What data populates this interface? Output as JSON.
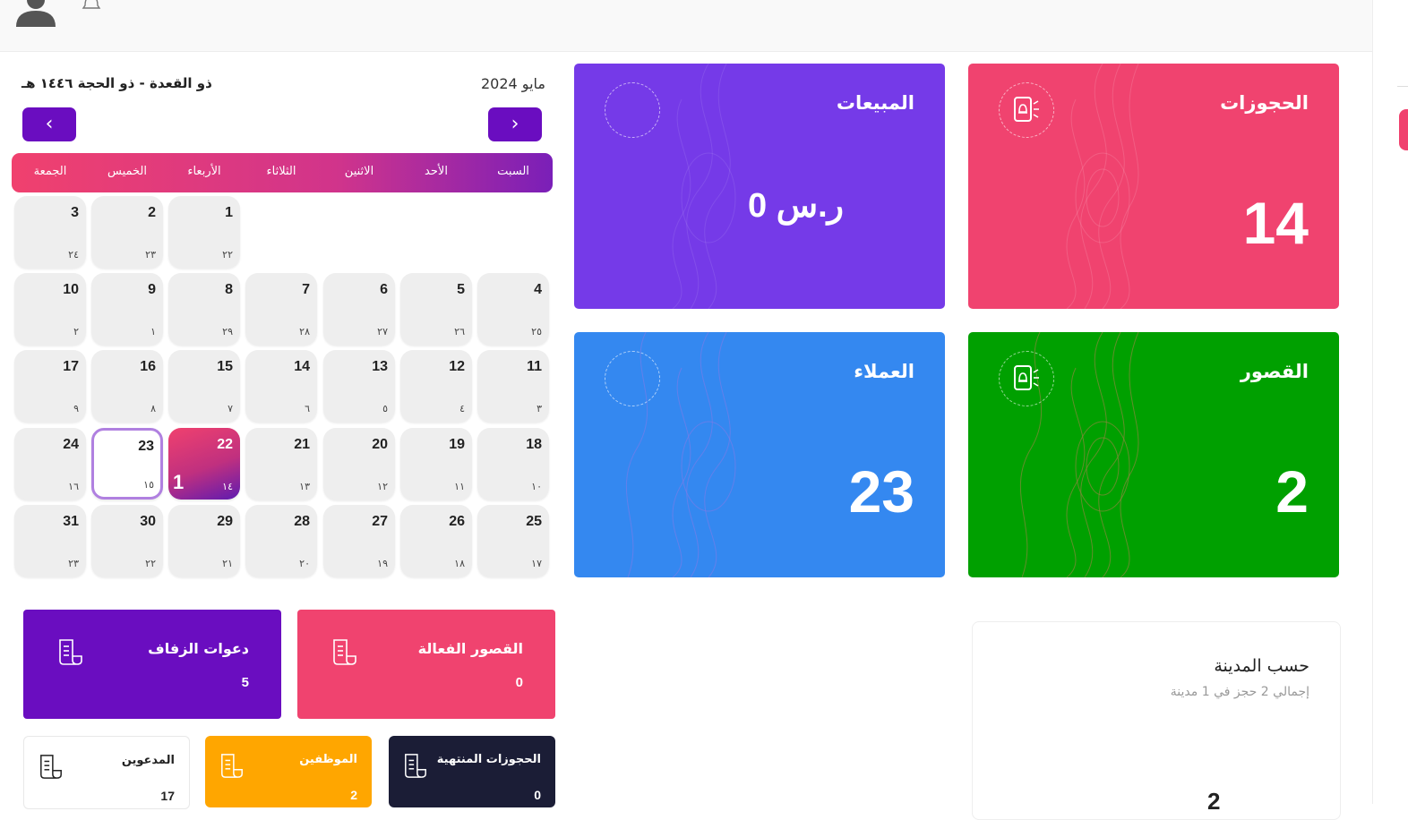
{
  "stats": {
    "bookings": {
      "title": "الحجوزات",
      "value": "14",
      "color": "#f0436f"
    },
    "sales": {
      "title": "المبيعات",
      "value": "0 ر.س",
      "color": "#753ae8"
    },
    "palaces": {
      "title": "القصور",
      "value": "2",
      "color": "#00a000"
    },
    "customers": {
      "title": "العملاء",
      "value": "23",
      "color": "#3488f0"
    }
  },
  "calendar": {
    "month_label": "مايو 2024",
    "hijri_label": "ذو القعدة - ذو الحجة ١٤٤٦ هـ",
    "prev_arrow": "‹",
    "next_arrow": "›",
    "weekdays": [
      "السبت",
      "الأحد",
      "الاثنين",
      "الثلاثاء",
      "الأربعاء",
      "الخميس",
      "الجمعة"
    ],
    "weeks": [
      [
        null,
        null,
        null,
        null,
        {
          "g": "1",
          "h": "٢٢"
        },
        {
          "g": "2",
          "h": "٢٣"
        },
        {
          "g": "3",
          "h": "٢٤"
        }
      ],
      [
        {
          "g": "4",
          "h": "٢٥"
        },
        {
          "g": "5",
          "h": "٢٦"
        },
        {
          "g": "6",
          "h": "٢٧"
        },
        {
          "g": "7",
          "h": "٢٨"
        },
        {
          "g": "8",
          "h": "٢٩"
        },
        {
          "g": "9",
          "h": "١"
        },
        {
          "g": "10",
          "h": "٢"
        }
      ],
      [
        {
          "g": "11",
          "h": "٣"
        },
        {
          "g": "12",
          "h": "٤"
        },
        {
          "g": "13",
          "h": "٥"
        },
        {
          "g": "14",
          "h": "٦"
        },
        {
          "g": "15",
          "h": "٧"
        },
        {
          "g": "16",
          "h": "٨"
        },
        {
          "g": "17",
          "h": "٩"
        }
      ],
      [
        {
          "g": "18",
          "h": "١٠"
        },
        {
          "g": "19",
          "h": "١١"
        },
        {
          "g": "20",
          "h": "١٢"
        },
        {
          "g": "21",
          "h": "١٣"
        },
        {
          "g": "22",
          "h": "١٤",
          "count": "1",
          "active": true
        },
        {
          "g": "23",
          "h": "١٥",
          "today": true
        },
        {
          "g": "24",
          "h": "١٦"
        }
      ],
      [
        {
          "g": "25",
          "h": "١٧"
        },
        {
          "g": "26",
          "h": "١٨"
        },
        {
          "g": "27",
          "h": "١٩"
        },
        {
          "g": "28",
          "h": "٢٠"
        },
        {
          "g": "29",
          "h": "٢١"
        },
        {
          "g": "30",
          "h": "٢٢"
        },
        {
          "g": "31",
          "h": "٢٣"
        }
      ]
    ]
  },
  "summary": {
    "active_palaces": {
      "title": "القصور الفعالة",
      "value": "0",
      "color": "#f0436f"
    },
    "wedding_invites": {
      "title": "دعوات الزفاف",
      "value": "5",
      "color": "#6a0dc0"
    },
    "finished_bookings": {
      "title": "الحجوزات المنتهية",
      "value": "0",
      "color": "#1b1d36"
    },
    "employees": {
      "title": "الموظفين",
      "value": "2",
      "color": "#ffa600"
    },
    "invitees": {
      "title": "المدعوين",
      "value": "17",
      "color": "#ffffff"
    }
  },
  "city": {
    "title": "حسب المدينة",
    "subtitle": "إجمالي 2 حجز في 1 مدينة",
    "number": "2"
  }
}
